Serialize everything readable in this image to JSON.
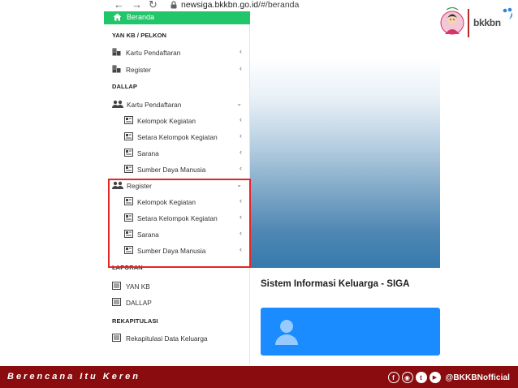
{
  "browser": {
    "url_host": "newsiga.bkkbn.go.id",
    "url_path": "/#/beranda",
    "back_icon": "arrow-left-icon",
    "forward_icon": "arrow-right-icon",
    "reload_icon": "reload-icon",
    "lock_icon": "lock-icon"
  },
  "sidebar": {
    "active_item": "Beranda",
    "sections": [
      {
        "title": "YAN KB / PELKON",
        "items": [
          {
            "label": "Kartu Pendaftaran",
            "icon": "building-icon"
          },
          {
            "label": "Register",
            "icon": "building-icon"
          }
        ]
      },
      {
        "title": "DALLAP",
        "items": [
          {
            "label": "Kartu Pendaftaran",
            "icon": "users-icon",
            "expanded": true,
            "children": [
              "Kelompok Kegiatan",
              "Setara Kelompok Kegiatan",
              "Sarana",
              "Sumber Daya Manusia"
            ]
          },
          {
            "label": "Register",
            "icon": "users-icon",
            "expanded": true,
            "children": [
              "Kelompok Kegiatan",
              "Setara Kelompok Kegiatan",
              "Sarana",
              "Sumber Daya Manusia"
            ]
          }
        ]
      },
      {
        "title": "LAPORAN",
        "items": [
          {
            "label": "YAN KB",
            "icon": "list-icon"
          },
          {
            "label": "DALLAP",
            "icon": "list-icon"
          }
        ]
      },
      {
        "title": "REKAPITULASI",
        "items": [
          {
            "label": "Rekapitulasi Data Keluarga",
            "icon": "list-icon"
          }
        ]
      }
    ]
  },
  "main": {
    "title": "Sistem Informasi Keluarga - SIGA",
    "card_icon": "user-icon"
  },
  "brand": {
    "name": "bkkbn"
  },
  "footer": {
    "tagline": "Berencana Itu Keren",
    "handle": "@BKKBNofficial",
    "social_icons": [
      "facebook-icon",
      "instagram-icon",
      "twitter-icon",
      "youtube-icon"
    ]
  },
  "colors": {
    "active_nav": "#21c56a",
    "card_blue": "#1a8cff",
    "footer_red": "#8b0c0e",
    "highlight_red": "#e32626"
  }
}
